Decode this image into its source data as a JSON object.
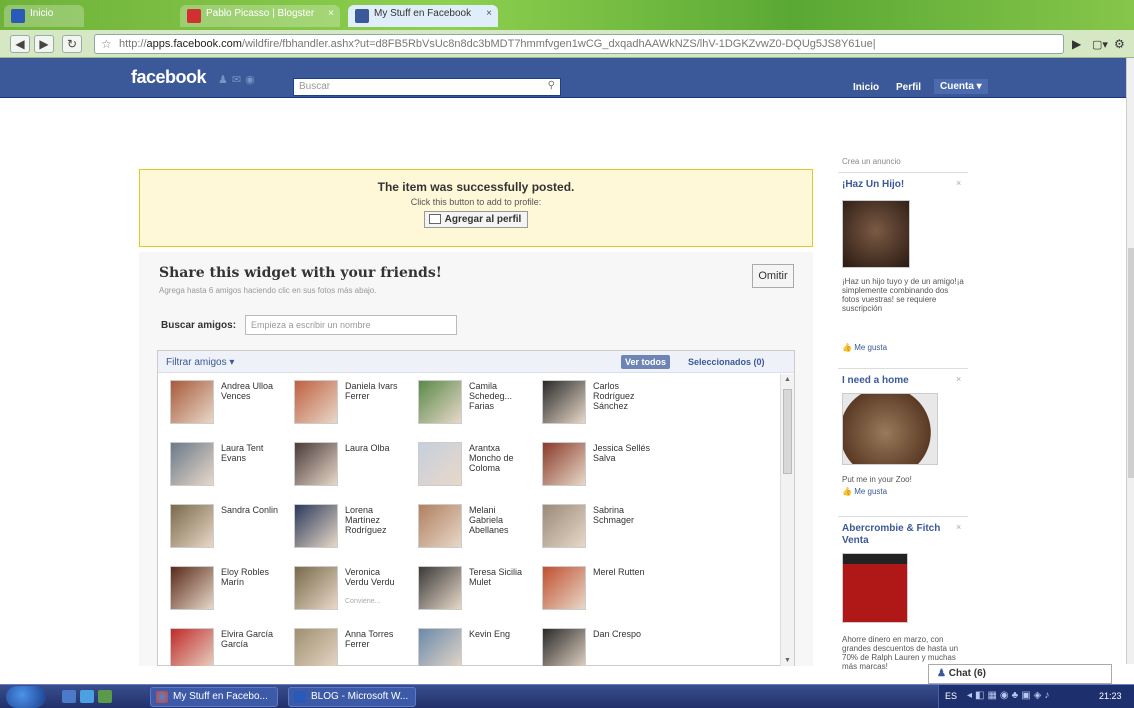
{
  "browser": {
    "tabs": [
      {
        "label": "Inicio",
        "fav": "#2a5ab8"
      },
      {
        "label": "Pablo Picasso | Blogster",
        "fav": "#d03030"
      },
      {
        "label": "My Stuff en Facebook",
        "fav": "#3b5998"
      }
    ],
    "url_prefix": "http://",
    "url_host": "apps.facebook.com",
    "url_rest": "/wildfire/fbhandler.ashx?ut=d8FB5RbVsUc8n8dc3bMDT7hmmfvgen1wCG_dxqadhAAWkNZS/lhV-1DGKZvwZ0-DQUg5JS8Y61ue|"
  },
  "facebook": {
    "logo": "facebook",
    "search_placeholder": "Buscar",
    "nav": {
      "inicio": "Inicio",
      "perfil": "Perfil",
      "cuenta": "Cuenta ▾"
    }
  },
  "notice": {
    "title": "The item was successfully posted.",
    "subtitle": "Click this button to add to profile:",
    "button": "Agregar al perfil"
  },
  "share": {
    "title": "Share this widget with your friends!",
    "subtitle": "Agrega hasta 6 amigos haciendo clic en sus fotos más abajo.",
    "omit": "Omitir",
    "search_label": "Buscar amigos:",
    "search_placeholder": "Empieza a escribir un nombre",
    "filter": "Filtrar amigos ▾",
    "see_all": "Ver todos",
    "selected": "Seleccionados (0)",
    "friends": [
      {
        "name": "Andrea Ulloa Vences",
        "c": "#a85a3a"
      },
      {
        "name": "Daniela Ivars Ferrer",
        "c": "#c06040"
      },
      {
        "name": "Camila Schedeg... Farias",
        "c": "#5a8a4a"
      },
      {
        "name": "Carlos Rodríguez Sánchez",
        "c": "#2a2a2a"
      },
      {
        "name": "Laura Tent Evans",
        "c": "#6a7a8a"
      },
      {
        "name": "Laura Olba",
        "c": "#4a3a3a"
      },
      {
        "name": "Arantxa Moncho de Coloma",
        "c": "#c6cfdf"
      },
      {
        "name": "Jessica Sellés Salva",
        "c": "#8a3a2a"
      },
      {
        "name": "Sandra Conlin",
        "c": "#7a6a4a"
      },
      {
        "name": "Lorena Martínez Rodríguez",
        "c": "#2a3a5a"
      },
      {
        "name": "Melani Gabriela Abellanes",
        "c": "#b08060"
      },
      {
        "name": "Sabrina Schmager",
        "c": "#9a8a7a"
      },
      {
        "name": "Eloy Robles Marín",
        "c": "#5a2a1a"
      },
      {
        "name": "Veronica Verdu Verdu",
        "c": "#7a6a4a",
        "note": "Conviene..."
      },
      {
        "name": "Teresa Sicilia Mulet",
        "c": "#3a3a3a"
      },
      {
        "name": "Merel Rutten",
        "c": "#c05030"
      },
      {
        "name": "Elvira García García",
        "c": "#c02a2a"
      },
      {
        "name": "Anna Torres Ferrer",
        "c": "#a09070"
      },
      {
        "name": "Kevin Eng",
        "c": "#6a8aaa"
      },
      {
        "name": "Dan Crespo",
        "c": "#2a2a2a"
      }
    ]
  },
  "ads": {
    "create": "Crea un anuncio",
    "items": [
      {
        "title": "¡Haz Un Hijo!",
        "text": "¡Haz un hijo tuyo y de un amigo!¡a simplemente combinando dos fotos vuestras! se requiere suscripción",
        "like": "Me gusta",
        "c": "#5a3a2a"
      },
      {
        "title": "I need a home",
        "text": "Put me in your Zoo!",
        "like": "Me gusta",
        "c": "#8a6a4a"
      },
      {
        "title": "Abercrombie & Fitch Venta",
        "text": "Ahorre dinero en marzo, con grandes descuentos de hasta un 70% de Ralph Lauren y muchas más marcas!",
        "like": "",
        "c": "#b01818"
      }
    ]
  },
  "chat": "Chat (6)",
  "taskbar": {
    "items": [
      "My Stuff en Facebo...",
      "BLOG - Microsoft W..."
    ],
    "lang": "ES",
    "time": "21:23"
  }
}
